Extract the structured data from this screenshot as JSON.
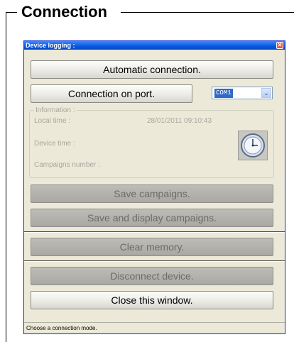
{
  "frame": {
    "title": "Connection"
  },
  "window": {
    "title": "Device logging :",
    "close_glyph": "✕",
    "buttons": {
      "automatic": "Automatic connection.",
      "connection_on_port": "Connection on port.",
      "save_campaigns": "Save campaigns.",
      "save_display_campaigns": "Save and display campaigns.",
      "clear_memory": "Clear memory.",
      "disconnect": "Disconnect device.",
      "close": "Close this window."
    },
    "port_select": {
      "value": "COM1",
      "arrow_glyph": "⌄"
    },
    "information": {
      "legend": "Information :",
      "local_time_label": "Local time :",
      "local_time_value": "28/01/2011 09:10:43",
      "device_time_label": "Device time :",
      "campaigns_number_label": "Campaigns number :"
    },
    "status": "Choose a connection mode."
  },
  "colors": {
    "titlebar": "#0a55e0",
    "window_bg": "#ece9d8",
    "select_highlight": "#316ac5"
  },
  "icons": {
    "clock": "clock-icon"
  }
}
